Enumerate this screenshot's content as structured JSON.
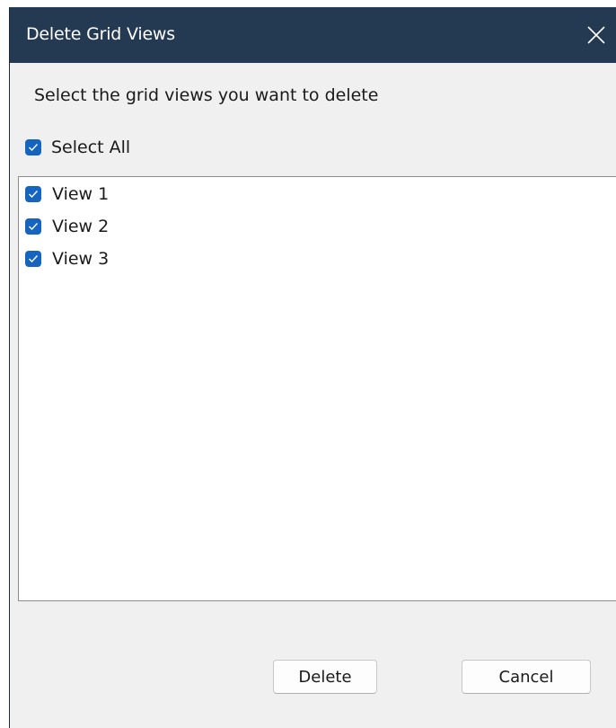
{
  "window": {
    "title": "Delete Grid Views"
  },
  "dialog": {
    "instruction": "Select the grid views you want to delete",
    "select_all": {
      "label": "Select All",
      "checked": true
    },
    "views": [
      {
        "label": "View 1",
        "checked": true
      },
      {
        "label": "View 2",
        "checked": true
      },
      {
        "label": "View 3",
        "checked": true
      }
    ]
  },
  "buttons": {
    "delete_label": "Delete",
    "cancel_label": "Cancel"
  },
  "icons": {
    "close": "close-icon",
    "checkbox_checked": "checkmark-icon"
  },
  "colors": {
    "titlebar": "#243a53",
    "checkbox": "#1565c0",
    "dialog_bg": "#f0f0f0"
  }
}
